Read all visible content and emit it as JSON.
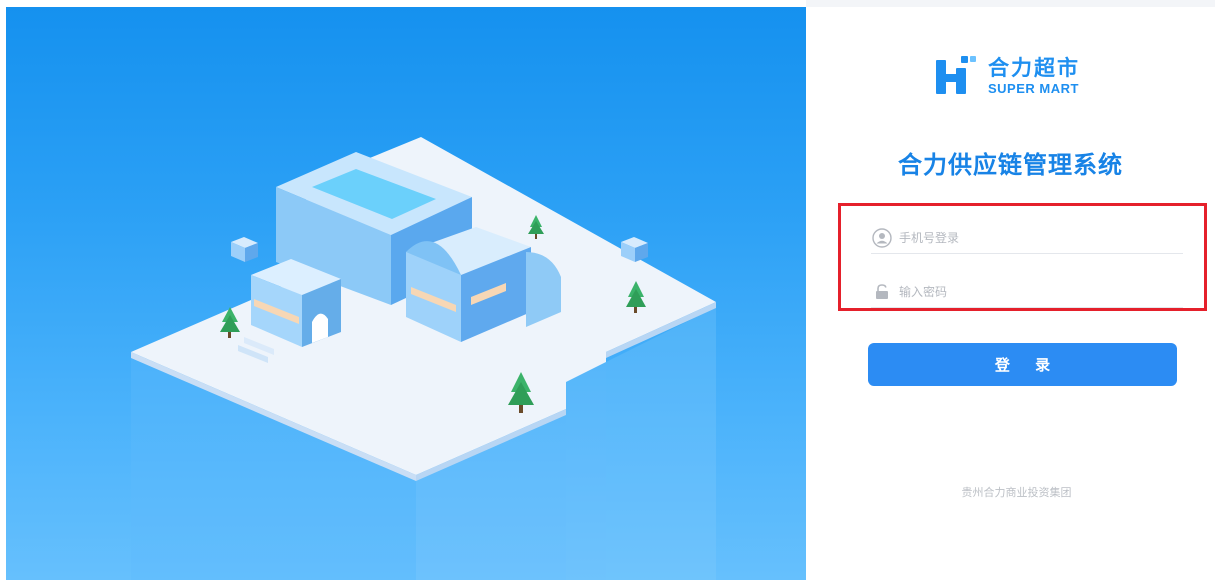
{
  "brand": {
    "name_cn": "合力超市",
    "name_en": "SUPER MART",
    "primary_color": "#1e8ff0",
    "logo_icon": "hi-logo-icon"
  },
  "title": "合力供应链管理系统",
  "login_form": {
    "phone_placeholder": "手机号登录",
    "password_placeholder": "输入密码",
    "phone_icon": "user-icon",
    "password_icon": "lock-icon",
    "highlight_color": "#e5202b"
  },
  "login_button": {
    "label": "登 录",
    "color": "#2c8cf3"
  },
  "footer": {
    "text": "贵州合力商业投资集团"
  },
  "illustration": {
    "name": "isometric-supermarket-illustration",
    "background_color": "#2b9ff5"
  }
}
